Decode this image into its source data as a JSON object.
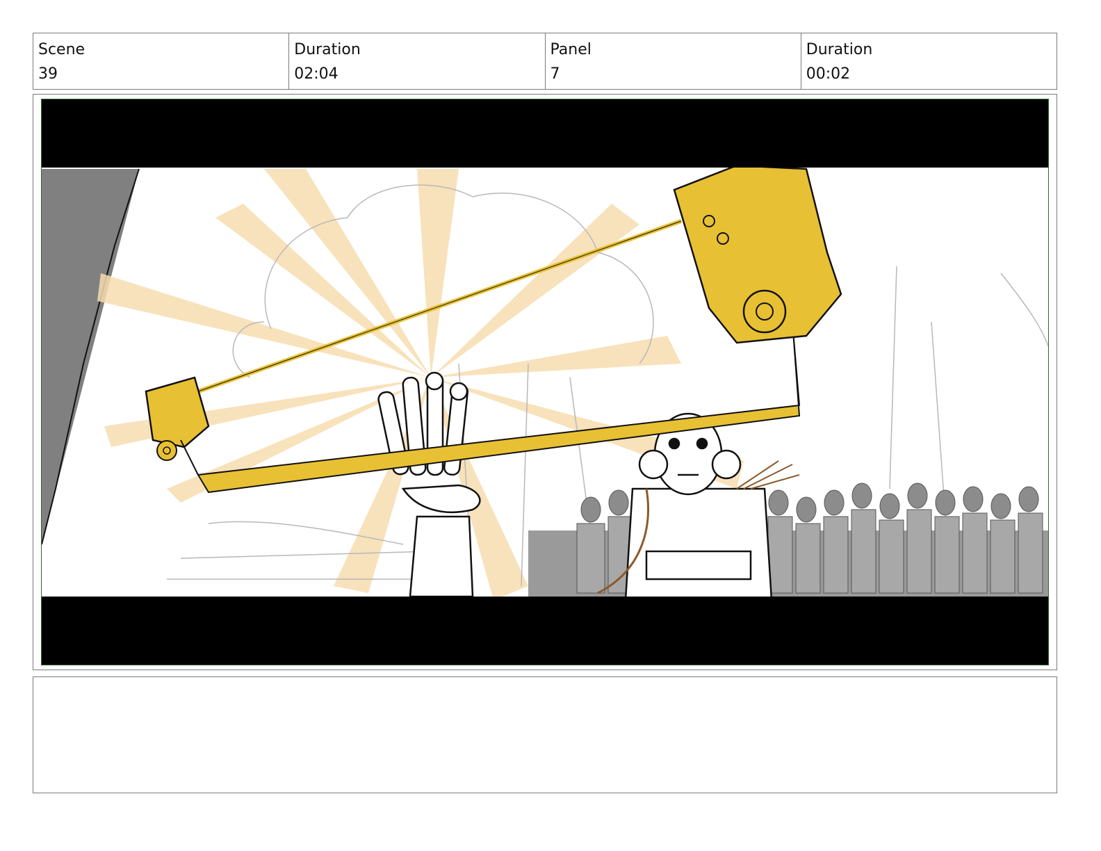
{
  "header": {
    "scene_label": "Scene",
    "scene_value": "39",
    "scene_duration_label": "Duration",
    "scene_duration_value": "02:04",
    "panel_label": "Panel",
    "panel_value": "7",
    "panel_duration_label": "Duration",
    "panel_duration_value": "00:02"
  },
  "panel": {
    "frame_border_color": "#2e6b2e",
    "letterbox_color": "#000000",
    "accent_gold": "#e8c033",
    "ray_color": "#f7ddb0",
    "crowd_gray": "#9a9a9a"
  },
  "notes": {
    "text": ""
  }
}
